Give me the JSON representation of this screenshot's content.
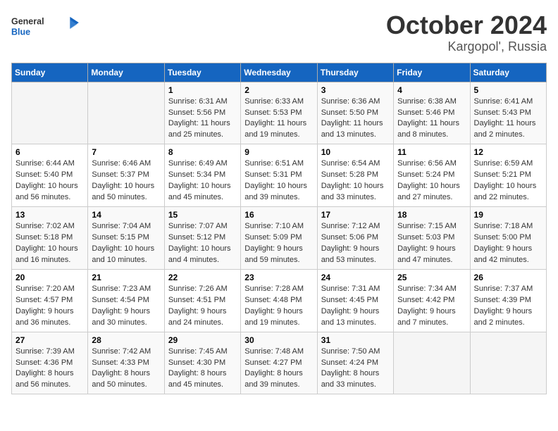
{
  "header": {
    "logo_general": "General",
    "logo_blue": "Blue",
    "title": "October 2024",
    "subtitle": "Kargopol', Russia"
  },
  "days_of_week": [
    "Sunday",
    "Monday",
    "Tuesday",
    "Wednesday",
    "Thursday",
    "Friday",
    "Saturday"
  ],
  "weeks": [
    [
      {
        "day": "",
        "sunrise": "",
        "sunset": "",
        "daylight": ""
      },
      {
        "day": "",
        "sunrise": "",
        "sunset": "",
        "daylight": ""
      },
      {
        "day": "1",
        "sunrise": "Sunrise: 6:31 AM",
        "sunset": "Sunset: 5:56 PM",
        "daylight": "Daylight: 11 hours and 25 minutes."
      },
      {
        "day": "2",
        "sunrise": "Sunrise: 6:33 AM",
        "sunset": "Sunset: 5:53 PM",
        "daylight": "Daylight: 11 hours and 19 minutes."
      },
      {
        "day": "3",
        "sunrise": "Sunrise: 6:36 AM",
        "sunset": "Sunset: 5:50 PM",
        "daylight": "Daylight: 11 hours and 13 minutes."
      },
      {
        "day": "4",
        "sunrise": "Sunrise: 6:38 AM",
        "sunset": "Sunset: 5:46 PM",
        "daylight": "Daylight: 11 hours and 8 minutes."
      },
      {
        "day": "5",
        "sunrise": "Sunrise: 6:41 AM",
        "sunset": "Sunset: 5:43 PM",
        "daylight": "Daylight: 11 hours and 2 minutes."
      }
    ],
    [
      {
        "day": "6",
        "sunrise": "Sunrise: 6:44 AM",
        "sunset": "Sunset: 5:40 PM",
        "daylight": "Daylight: 10 hours and 56 minutes."
      },
      {
        "day": "7",
        "sunrise": "Sunrise: 6:46 AM",
        "sunset": "Sunset: 5:37 PM",
        "daylight": "Daylight: 10 hours and 50 minutes."
      },
      {
        "day": "8",
        "sunrise": "Sunrise: 6:49 AM",
        "sunset": "Sunset: 5:34 PM",
        "daylight": "Daylight: 10 hours and 45 minutes."
      },
      {
        "day": "9",
        "sunrise": "Sunrise: 6:51 AM",
        "sunset": "Sunset: 5:31 PM",
        "daylight": "Daylight: 10 hours and 39 minutes."
      },
      {
        "day": "10",
        "sunrise": "Sunrise: 6:54 AM",
        "sunset": "Sunset: 5:28 PM",
        "daylight": "Daylight: 10 hours and 33 minutes."
      },
      {
        "day": "11",
        "sunrise": "Sunrise: 6:56 AM",
        "sunset": "Sunset: 5:24 PM",
        "daylight": "Daylight: 10 hours and 27 minutes."
      },
      {
        "day": "12",
        "sunrise": "Sunrise: 6:59 AM",
        "sunset": "Sunset: 5:21 PM",
        "daylight": "Daylight: 10 hours and 22 minutes."
      }
    ],
    [
      {
        "day": "13",
        "sunrise": "Sunrise: 7:02 AM",
        "sunset": "Sunset: 5:18 PM",
        "daylight": "Daylight: 10 hours and 16 minutes."
      },
      {
        "day": "14",
        "sunrise": "Sunrise: 7:04 AM",
        "sunset": "Sunset: 5:15 PM",
        "daylight": "Daylight: 10 hours and 10 minutes."
      },
      {
        "day": "15",
        "sunrise": "Sunrise: 7:07 AM",
        "sunset": "Sunset: 5:12 PM",
        "daylight": "Daylight: 10 hours and 4 minutes."
      },
      {
        "day": "16",
        "sunrise": "Sunrise: 7:10 AM",
        "sunset": "Sunset: 5:09 PM",
        "daylight": "Daylight: 9 hours and 59 minutes."
      },
      {
        "day": "17",
        "sunrise": "Sunrise: 7:12 AM",
        "sunset": "Sunset: 5:06 PM",
        "daylight": "Daylight: 9 hours and 53 minutes."
      },
      {
        "day": "18",
        "sunrise": "Sunrise: 7:15 AM",
        "sunset": "Sunset: 5:03 PM",
        "daylight": "Daylight: 9 hours and 47 minutes."
      },
      {
        "day": "19",
        "sunrise": "Sunrise: 7:18 AM",
        "sunset": "Sunset: 5:00 PM",
        "daylight": "Daylight: 9 hours and 42 minutes."
      }
    ],
    [
      {
        "day": "20",
        "sunrise": "Sunrise: 7:20 AM",
        "sunset": "Sunset: 4:57 PM",
        "daylight": "Daylight: 9 hours and 36 minutes."
      },
      {
        "day": "21",
        "sunrise": "Sunrise: 7:23 AM",
        "sunset": "Sunset: 4:54 PM",
        "daylight": "Daylight: 9 hours and 30 minutes."
      },
      {
        "day": "22",
        "sunrise": "Sunrise: 7:26 AM",
        "sunset": "Sunset: 4:51 PM",
        "daylight": "Daylight: 9 hours and 24 minutes."
      },
      {
        "day": "23",
        "sunrise": "Sunrise: 7:28 AM",
        "sunset": "Sunset: 4:48 PM",
        "daylight": "Daylight: 9 hours and 19 minutes."
      },
      {
        "day": "24",
        "sunrise": "Sunrise: 7:31 AM",
        "sunset": "Sunset: 4:45 PM",
        "daylight": "Daylight: 9 hours and 13 minutes."
      },
      {
        "day": "25",
        "sunrise": "Sunrise: 7:34 AM",
        "sunset": "Sunset: 4:42 PM",
        "daylight": "Daylight: 9 hours and 7 minutes."
      },
      {
        "day": "26",
        "sunrise": "Sunrise: 7:37 AM",
        "sunset": "Sunset: 4:39 PM",
        "daylight": "Daylight: 9 hours and 2 minutes."
      }
    ],
    [
      {
        "day": "27",
        "sunrise": "Sunrise: 7:39 AM",
        "sunset": "Sunset: 4:36 PM",
        "daylight": "Daylight: 8 hours and 56 minutes."
      },
      {
        "day": "28",
        "sunrise": "Sunrise: 7:42 AM",
        "sunset": "Sunset: 4:33 PM",
        "daylight": "Daylight: 8 hours and 50 minutes."
      },
      {
        "day": "29",
        "sunrise": "Sunrise: 7:45 AM",
        "sunset": "Sunset: 4:30 PM",
        "daylight": "Daylight: 8 hours and 45 minutes."
      },
      {
        "day": "30",
        "sunrise": "Sunrise: 7:48 AM",
        "sunset": "Sunset: 4:27 PM",
        "daylight": "Daylight: 8 hours and 39 minutes."
      },
      {
        "day": "31",
        "sunrise": "Sunrise: 7:50 AM",
        "sunset": "Sunset: 4:24 PM",
        "daylight": "Daylight: 8 hours and 33 minutes."
      },
      {
        "day": "",
        "sunrise": "",
        "sunset": "",
        "daylight": ""
      },
      {
        "day": "",
        "sunrise": "",
        "sunset": "",
        "daylight": ""
      }
    ]
  ]
}
